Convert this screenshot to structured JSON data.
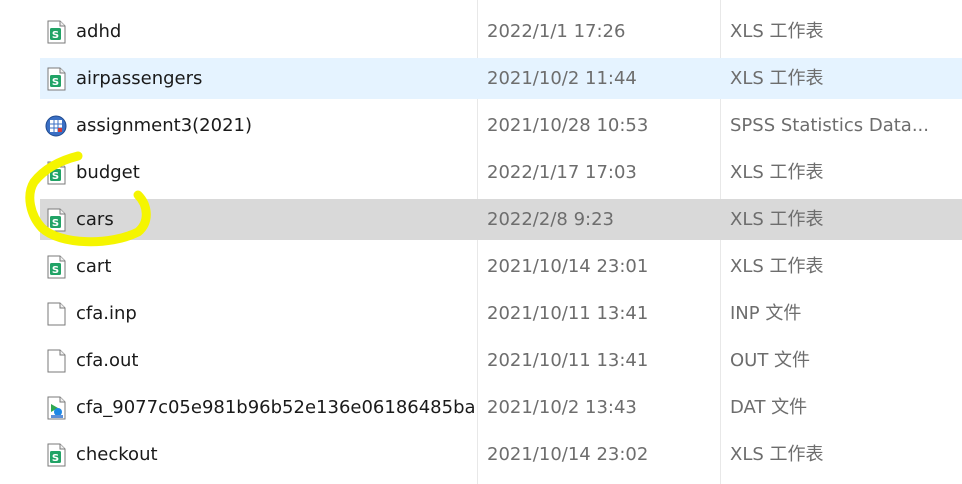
{
  "files": [
    {
      "name": "adhd",
      "date": "2022/1/1 17:26",
      "type": "XLS 工作表",
      "icon": "xls-icon",
      "state": "normal"
    },
    {
      "name": "airpassengers",
      "date": "2021/10/2 11:44",
      "type": "XLS 工作表",
      "icon": "xls-icon",
      "state": "hover"
    },
    {
      "name": "assignment3(2021)",
      "date": "2021/10/28 10:53",
      "type": "SPSS Statistics Data...",
      "icon": "spss-data-icon",
      "state": "normal"
    },
    {
      "name": "budget",
      "date": "2022/1/17 17:03",
      "type": "XLS 工作表",
      "icon": "xls-icon",
      "state": "normal"
    },
    {
      "name": "cars",
      "date": "2022/2/8 9:23",
      "type": "XLS 工作表",
      "icon": "xls-icon",
      "state": "selected"
    },
    {
      "name": "cart",
      "date": "2021/10/14 23:01",
      "type": "XLS 工作表",
      "icon": "xls-icon",
      "state": "normal"
    },
    {
      "name": "cfa.inp",
      "date": "2021/10/11 13:41",
      "type": "INP 文件",
      "icon": "generic-file-icon",
      "state": "normal"
    },
    {
      "name": "cfa.out",
      "date": "2021/10/11 13:41",
      "type": "OUT 文件",
      "icon": "generic-file-icon",
      "state": "normal"
    },
    {
      "name": "cfa_9077c05e981b96b52e136e06186485ba",
      "date": "2021/10/2 13:43",
      "type": "DAT 文件",
      "icon": "media-file-icon",
      "state": "normal"
    },
    {
      "name": "checkout",
      "date": "2021/10/14 23:02",
      "type": "XLS 工作表",
      "icon": "xls-icon",
      "state": "normal"
    }
  ],
  "colors": {
    "hover": "#e5f3ff",
    "selected": "#d9d9d9",
    "xls_green": "#21a366",
    "annotation_yellow": "#f5f500"
  }
}
